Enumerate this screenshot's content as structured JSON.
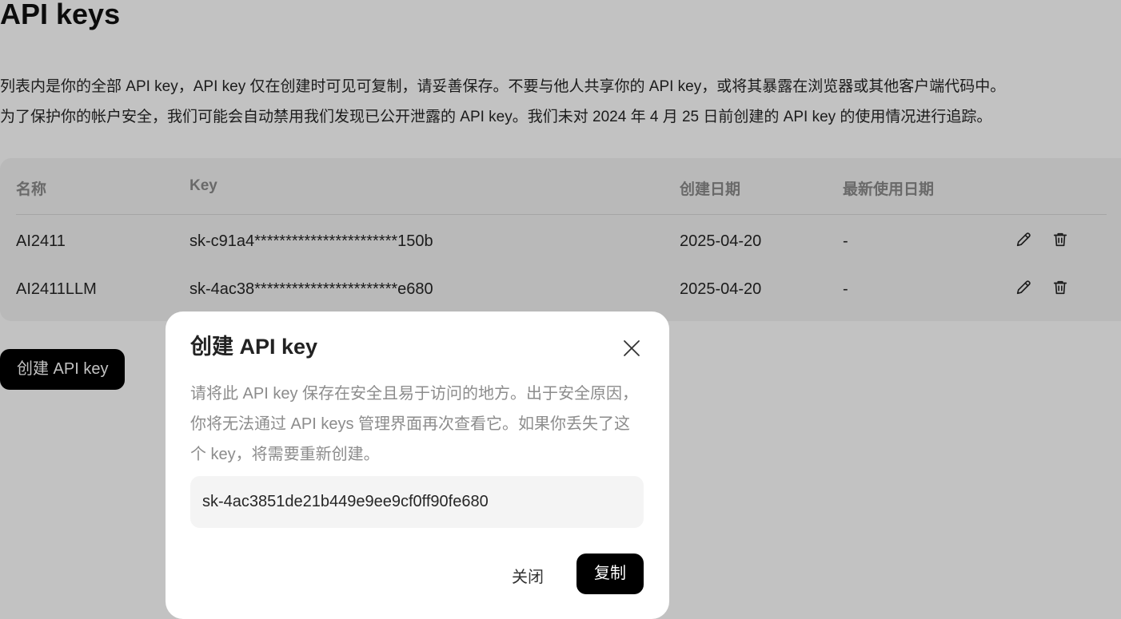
{
  "page": {
    "title": "API keys",
    "description_line1": "列表内是你的全部 API key，API key 仅在创建时可见可复制，请妥善保存。不要与他人共享你的 API key，或将其暴露在浏览器或其他客户端代码中。",
    "description_line2": "为了保护你的帐户安全，我们可能会自动禁用我们发现已公开泄露的 API key。我们未对 2024 年 4 月 25 日前创建的 API key 的使用情况进行追踪。"
  },
  "table": {
    "headers": {
      "name": "名称",
      "key": "Key",
      "created": "创建日期",
      "last_used": "最新使用日期"
    },
    "rows": [
      {
        "name": "AI2411",
        "key": "sk-c91a4***********************150b",
        "created": "2025-04-20",
        "last_used": "-"
      },
      {
        "name": "AI2411LLM",
        "key": "sk-4ac38***********************e680",
        "created": "2025-04-20",
        "last_used": "-"
      }
    ],
    "row_actions": [
      "edit-icon",
      "trash-icon"
    ]
  },
  "create_button": {
    "label": "创建 API key"
  },
  "modal": {
    "title": "创建 API key",
    "description": "请将此 API key 保存在安全且易于访问的地方。出于安全原因，你将无法通过 API keys 管理界面再次查看它。如果你丢失了这个 key，将需要重新创建。",
    "key_value": "sk-4ac3851de21b449e9ee9cf0ff90fe680",
    "close_label": "关闭",
    "copy_label": "复制",
    "close_icon": "close-icon"
  },
  "colors": {
    "overlay": "#000000",
    "primary_button": "#000000",
    "card_background": "#f3f3f3"
  }
}
